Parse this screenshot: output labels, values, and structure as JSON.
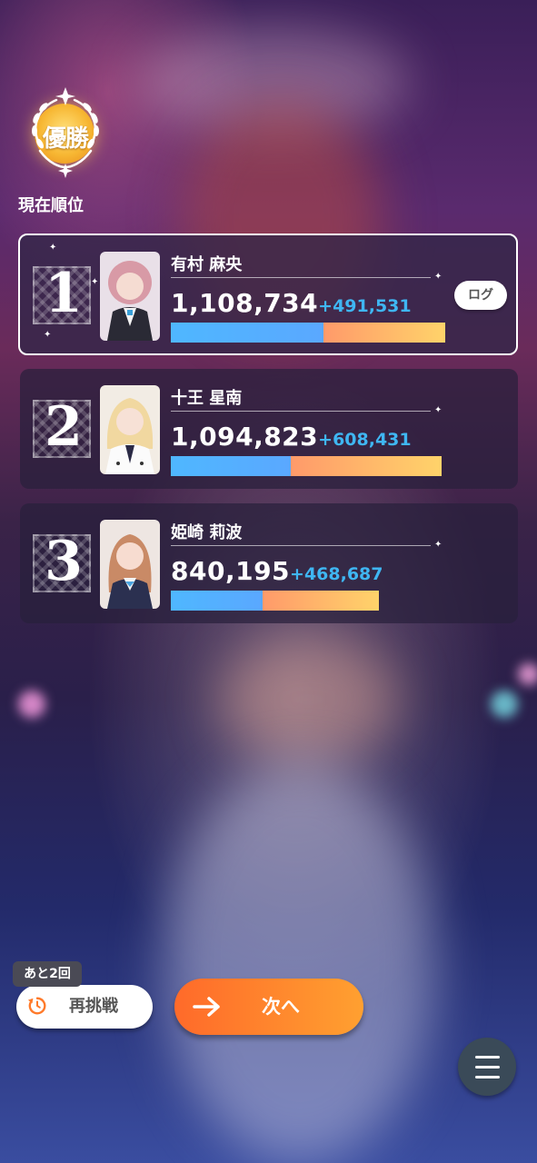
{
  "badge": {
    "label": "優勝"
  },
  "current_rank_label": "現在順位",
  "rankings": [
    {
      "rank": "1",
      "name": "有村 麻央",
      "score": "1,108,734",
      "delta": "+491,531",
      "base_fraction": 0.556,
      "gain_fraction": 0.444,
      "bar_color_base": "#4fb7ff",
      "bar_color_gain": "#ffb85a"
    },
    {
      "rank": "2",
      "name": "十王 星南",
      "score": "1,094,823",
      "delta": "+608,431",
      "base_fraction": 0.444,
      "gain_fraction": 0.556,
      "bar_color_base": "#4fb7ff",
      "bar_color_gain": "#ffb85a"
    },
    {
      "rank": "3",
      "name": "姫崎 莉波",
      "score": "840,195",
      "delta": "+468,687",
      "base_fraction": 0.44,
      "gain_fraction": 0.56,
      "bar_color_base": "#4fb7ff",
      "bar_color_gain": "#ffb85a"
    }
  ],
  "log_button": {
    "label": "ログ"
  },
  "remaining": {
    "label": "あと2回"
  },
  "retry_button": {
    "label": "再挑戦",
    "icon": "retry-icon"
  },
  "next_button": {
    "label": "次へ",
    "icon": "arrow-right-icon"
  },
  "menu_button": {
    "icon": "hamburger-menu-icon"
  },
  "accent_colors": {
    "next": "#ff7a2a",
    "delta": "#3fb6f2"
  }
}
